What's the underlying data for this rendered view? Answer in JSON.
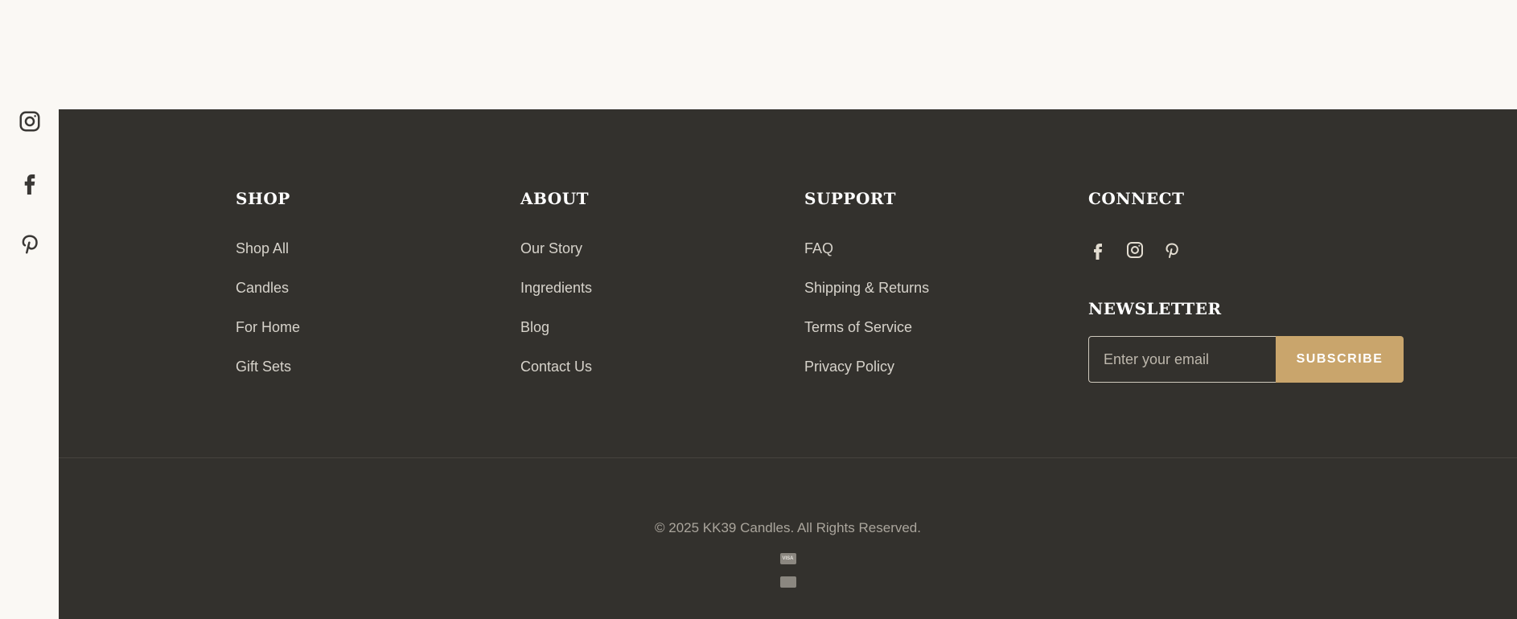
{
  "side_social": {
    "icons": [
      "instagram-icon",
      "facebook-icon",
      "pinterest-icon"
    ]
  },
  "footer": {
    "columns": [
      {
        "heading": "SHOP",
        "links": [
          "Shop All",
          "Candles",
          "For Home",
          "Gift Sets"
        ]
      },
      {
        "heading": "ABOUT",
        "links": [
          "Our Story",
          "Ingredients",
          "Blog",
          "Contact Us"
        ]
      },
      {
        "heading": "SUPPORT",
        "links": [
          "FAQ",
          "Shipping & Returns",
          "Terms of Service",
          "Privacy Policy"
        ]
      }
    ],
    "connect": {
      "heading": "CONNECT",
      "icons": [
        "facebook-icon",
        "instagram-icon",
        "pinterest-icon"
      ],
      "newsletter_heading": "NEWSLETTER",
      "email_placeholder": "Enter your email",
      "subscribe_label": "SUBSCRIBE"
    },
    "copyright": "© 2025 KK39 Candles. All Rights Reserved.",
    "payment_icons": [
      {
        "name": "visa-icon",
        "text": "VISA"
      },
      {
        "name": "card-icon",
        "text": ""
      }
    ]
  },
  "colors": {
    "page_bg": "#faf8f4",
    "footer_bg": "#33312d",
    "accent": "#c9a56c",
    "link": "#d7d3cb",
    "heading": "#ffffff"
  }
}
